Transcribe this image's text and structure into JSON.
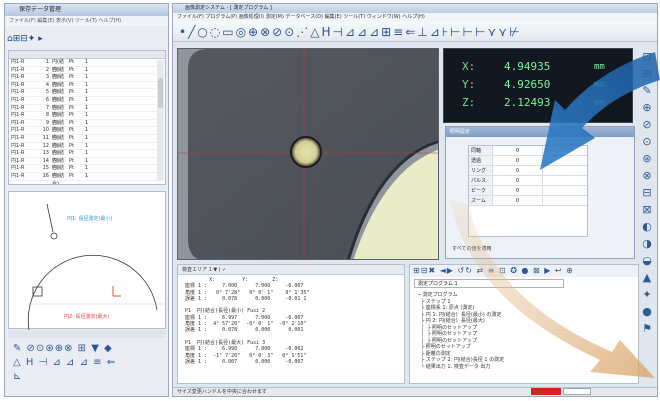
{
  "left_window": {
    "title": "保存データ管理",
    "menu": "ファイル(F)  編集(E)  表示(V)  ツール(T)  ヘルプ(H)",
    "toolbar_glyphs": "⌂⊞⊟✦ ▸",
    "table_rows": [
      [
        "円1-R",
        "1",
        "円(結合)",
        "Pt",
        "1"
      ],
      [
        "円1-R",
        "2",
        "円(結合)",
        "Pt",
        "1"
      ],
      [
        "円1-R",
        "3",
        "円(結合)",
        "Pt",
        "1"
      ],
      [
        "円1-R",
        "4",
        "円(結合)",
        "Pt",
        "1"
      ],
      [
        "円1-R",
        "5",
        "円(結合)",
        "Pt",
        "1"
      ],
      [
        "円1-R",
        "6",
        "円(結合)",
        "Pt",
        "1"
      ],
      [
        "円1-R",
        "7",
        "円(結合)",
        "Pt",
        "1"
      ],
      [
        "円1-R",
        "8",
        "円(結合)",
        "Pt",
        "1"
      ],
      [
        "円1-R",
        "9",
        "円(結合)",
        "Pt",
        "1"
      ],
      [
        "円1-R",
        "10",
        "円(結合)",
        "Pt",
        "1"
      ],
      [
        "円1-R",
        "11",
        "円(結合)",
        "Pt",
        "1"
      ],
      [
        "円1-R",
        "12",
        "円(結合)",
        "Pt",
        "1"
      ],
      [
        "円1-R",
        "13",
        "円(結合)",
        "Pt",
        "1"
      ],
      [
        "円1-R",
        "14",
        "円(結合)",
        "Pt",
        "1"
      ],
      [
        "円1-R",
        "15",
        "円(結合)",
        "Pt",
        "1"
      ],
      [
        "円1-R",
        "16",
        "円(結合)",
        "Pt",
        "1"
      ]
    ],
    "graph_label_top": "円1: 長径測定(最小)",
    "graph_label_bottom": "円2: 長径測定(最大)",
    "bottom_tools": "✎ ⊘⊙⊛⊕⊗ ⊞ ▼ ◆\n△ H ⊣ ⊿ ⊿ ⊿ ≡ ⇐\n⊾"
  },
  "main_window": {
    "title": "画像測定システム - [ 測定プログラム ]",
    "menu": "ファイル(F)  プログラム(P)  画像処理(I)  測定(M)  データベース(D)  編集(E)  ツール(T)  ウィンドウ(W)  ヘルプ(H)",
    "toolbar_glyphs": "•╱○◌▭◎⊕⊗⊘⊙⋰△H⊣⊿⊿⊿⊞≡⇐⊥⊿⊦⊢⊢⊢⋎⋎⊬",
    "dro": {
      "x_label": "X:",
      "x_value": "4.94935",
      "y_label": "Y:",
      "y_value": "4.92650",
      "z_label": "Z:",
      "z_value": "2.12493",
      "unit": "mm"
    },
    "dialog": {
      "title": "照明設定",
      "rows": [
        {
          "label": "同軸",
          "value": "0"
        },
        {
          "label": "透過",
          "value": "0"
        },
        {
          "label": "リング",
          "value": "0"
        },
        {
          "label": "パルス",
          "value": "0"
        },
        {
          "label": "ピーク",
          "value": "0"
        },
        {
          "label": "ズーム",
          "value": "0"
        }
      ],
      "bottom_label": "すべての値を適用"
    },
    "results_bar": "検査エリア 1   ▼  |  ✓",
    "results_lines": "         X:         Y:        Z:\n 座標 1 :     7.000      7.000     -0.007\n 角度 1 :   0° 7'28\"   0° 0' 1\"    0° 1'35\"\n 誤差 1 :     0.078      0.000     -0.01 1\n\n P1  円(結合)長径(最小) Fusi 2\n 座標 1 :     6.997      7.000     -0.007\n 角度 1 :  4° 57'20\"  -0° 0' 1\"  -0° 2'10\"\n 誤差 1 :     0.078      0.000      0.001\n\n P1  円(結合)長径(最大) Fusi 3\n 座標 1 :     6.998      7.000     -0.002\n 角度 1 :  -1° 7'20\"   0° 0' 3\"   0° 1'51\"\n 誤差 1 :     0.007      0.000     -0.007",
    "program_toolbar": "⊞⊟✖ ◄▶ ↺↻ ⇄ ≡ ⊡ ✪ ● ⊠ ▶ ↩ ⊕",
    "program_select": "測定プログラム 1",
    "program_tree": "─ 測定プログラム\n  ├ ステップ 1\n  ├ 座標系 1: 原点 (測定)\n  ├ 円 1: 円(結合)  長径(最小) の測定\n  ├ 円 2: 円(結合)  長径(最大)\n  │  ├ 照明のセットアップ\n  │  ├ 照明のセットアップ\n  │  ├ 照明のセットアップ\n  ├ 照明のセットアップ\n  ├ 距離の測定\n  ├ ステップ 2: 円(結合)長径 1 の測定\n  └ 結果出力 1: 検査データ 出力",
    "status": "サイズ変更ハンドルを中央に合わせます"
  }
}
